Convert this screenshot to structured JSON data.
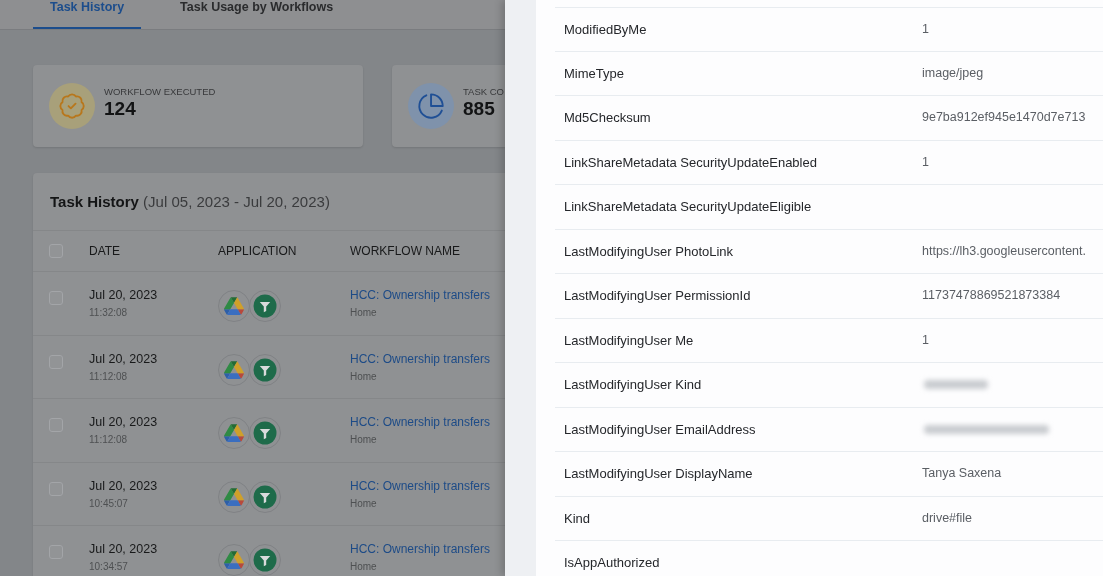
{
  "tabs": [
    {
      "label": "Task History",
      "selected": true
    },
    {
      "label": "Task Usage by Workflows",
      "selected": false
    }
  ],
  "stats": [
    {
      "kind": "badge",
      "label": "WORKFLOW EXECUTED",
      "value": "124"
    },
    {
      "kind": "pie",
      "label": "TASK CO",
      "value": "885"
    }
  ],
  "task_history": {
    "title": "**Task History** (Jul 05, 2023 - Jul 20, 2023)",
    "select_all": {
      "checked": false
    },
    "columns": [
      "DATE",
      "APPLICATION",
      "WORKFLOW NAME"
    ],
    "rows": [
      {
        "checked": false,
        "date": "Jul 20, 2023",
        "time": "11:32:08",
        "workflow": "HCC: Ownership transfers",
        "folder": "Home"
      },
      {
        "checked": false,
        "date": "Jul 20, 2023",
        "time": "11:12:08",
        "workflow": "HCC: Ownership transfers",
        "folder": "Home"
      },
      {
        "checked": false,
        "date": "Jul 20, 2023",
        "time": "11:12:08",
        "workflow": "HCC: Ownership transfers",
        "folder": "Home"
      },
      {
        "checked": false,
        "date": "Jul 20, 2023",
        "time": "10:45:07",
        "workflow": "HCC: Ownership transfers",
        "folder": "Home"
      },
      {
        "checked": false,
        "date": "Jul 20, 2023",
        "time": "10:34:57",
        "workflow": "HCC: Ownership transfers",
        "folder": "Home"
      }
    ]
  },
  "details": {
    "rows": [
      {
        "label": "ModifiedByMe",
        "value": "1",
        "redacted": false
      },
      {
        "label": "MimeType",
        "value": "image/jpeg",
        "redacted": false
      },
      {
        "label": "Md5Checksum",
        "value": "9e7ba912ef945e1470d7e713",
        "redacted": false
      },
      {
        "label": "LinkShareMetadata SecurityUpdateEnabled",
        "value": "1",
        "redacted": false
      },
      {
        "label": "LinkShareMetadata SecurityUpdateEligible",
        "redacted": false
      },
      {
        "label": "LastModifyingUser PhotoLink",
        "value": "https://lh3.googleusercontent.",
        "redacted": false
      },
      {
        "label": "LastModifyingUser PermissionId",
        "value": "11737478869521873384",
        "redacted": false
      },
      {
        "label": "LastModifyingUser Me",
        "value": "1",
        "redacted": false
      },
      {
        "label": "LastModifyingUser Kind",
        "redacted": true
      },
      {
        "label": "LastModifyingUser EmailAddress",
        "redacted": true
      },
      {
        "label": "LastModifyingUser DisplayName",
        "value": "Tanya Saxena",
        "redacted": false
      },
      {
        "label": "Kind",
        "value": "drive#file",
        "redacted": false
      },
      {
        "label": "IsAppAuthorized",
        "redacted": false
      }
    ]
  }
}
